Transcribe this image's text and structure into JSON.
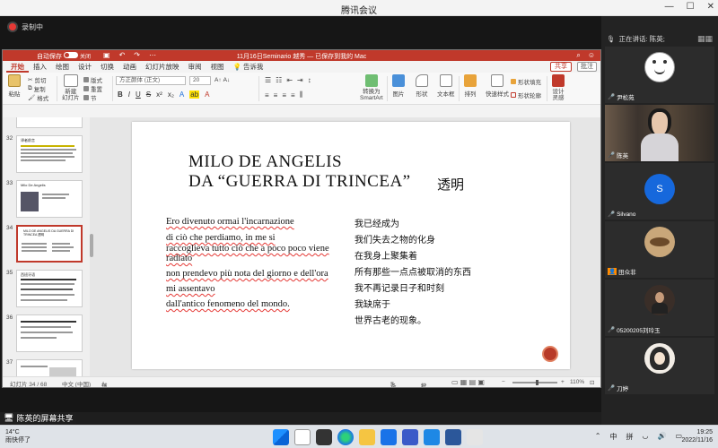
{
  "meeting": {
    "title": "腾讯会议",
    "recording_label": "录制中",
    "speaking_label": "正在讲话: 陈英;",
    "share_label": "陈英的屏幕共享"
  },
  "ppt": {
    "autosave_label": "自动保存",
    "toggle_label": "关闭",
    "doc_title": "11月16日Seminario 越秀 — 已保存到我的 Mac",
    "tabs": [
      "开始",
      "插入",
      "绘图",
      "设计",
      "切换",
      "动画",
      "幻灯片放映",
      "审阅",
      "视图"
    ],
    "tell_me": "告诉我",
    "share_button": "共享",
    "comment_button": "批注",
    "ribbon": {
      "paste": "粘贴",
      "cut": "剪切",
      "copy": "复制",
      "format": "格式",
      "new_slide": "新建\n幻灯片",
      "layout": "版式",
      "reset": "重置",
      "section": "节",
      "font": "方正颜体 (正文)",
      "size": "20",
      "convert_smartart": "转换为\nSmartArt",
      "picture": "图片",
      "shapes": "形状",
      "textbox": "文本框",
      "arrange": "排列",
      "quick_styles": "快速样式",
      "shape_fill": "形状填充",
      "shape_outline": "形状轮廓",
      "designer": "设计\n灵感"
    },
    "thumbnails": [
      {
        "num": "32",
        "label": "译者前言"
      },
      {
        "num": "33",
        "label": "Milo De Angelis"
      },
      {
        "num": "34",
        "label": "MILO DE ANGELIS DA GUERRA DI TRINCEA 透明"
      },
      {
        "num": "35",
        "label": "西班牙语"
      },
      {
        "num": "36",
        "label": ""
      },
      {
        "num": "37",
        "label": ""
      }
    ],
    "slide": {
      "title_line1": "MILO DE ANGELIS",
      "title_line2": "DA “GUERRA DI TRINCEA”",
      "title_cn": "透明",
      "it_lines": [
        "Ero divenuto ormai l'incarnazione",
        "di ciò che perdiamo, in me si",
        "raccoglieva  tutto ciò che a poco poco viene",
        "radiato",
        "non prendevo più nota del giorno e dell'ora",
        "mi assentavo",
        "dall'antico fenomeno del mondo."
      ],
      "cn_lines": [
        "我已经成为",
        "我们失去之物的化身",
        "在我身上聚集着",
        "所有那些一点点被取消的东西",
        "我不再记录日子和时刻",
        "我缺席于",
        "世界古老的现象。"
      ]
    },
    "status": {
      "slide_of": "幻灯片 34 / 68",
      "language": "中文 (中国)",
      "accessibility": "辅助功能: 调查",
      "notes": "备注",
      "comments": "批注",
      "zoom": "110%"
    }
  },
  "participants": [
    {
      "name": "尹松苑",
      "type": "avatar-cartoon"
    },
    {
      "name": "陈英",
      "type": "video"
    },
    {
      "name": "Silvano",
      "type": "initial",
      "initial": "S"
    },
    {
      "name": "田众非",
      "type": "avatar-moth"
    },
    {
      "name": "05200205刘玲玉",
      "type": "avatar-photo"
    },
    {
      "name": "刀婷",
      "type": "avatar-drawing"
    }
  ],
  "taskbar": {
    "temperature": "14°C",
    "weather": "雨快停了",
    "ime1": "中",
    "ime2": "拼",
    "time": "19:25",
    "date": "2022/11/16"
  }
}
